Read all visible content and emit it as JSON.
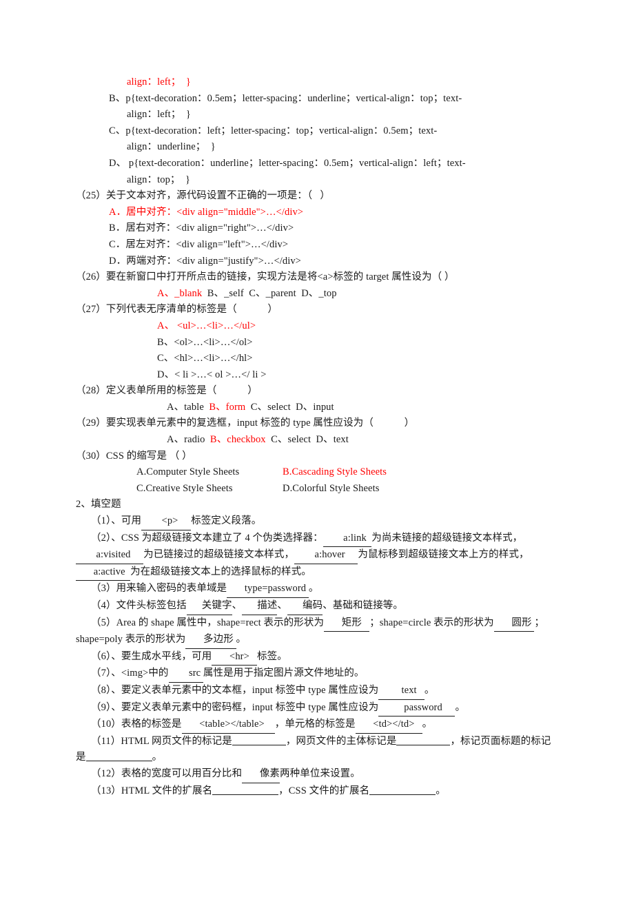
{
  "document": {
    "type": "exam-paper",
    "language": "zh-CN",
    "answer_color": "#ff0000",
    "text_color": "#1a1a1a",
    "background": "#ffffff"
  },
  "continued_question_24": {
    "note": "continuation of a previous multiple-choice question",
    "option_a_tail": "align：left；  }",
    "options": [
      {
        "label": "B、",
        "line1": "p{text-decoration：0.5em；letter-spacing：underline；vertical-align：top；text-",
        "line2": "align：left；  }",
        "is_answer": false
      },
      {
        "label": "C、",
        "line1": "p{text-decoration：left；letter-spacing：top；vertical-align：0.5em；text-",
        "line2": "align：underline；  }",
        "is_answer": false
      },
      {
        "label": "D、",
        "line1": " p{text-decoration：underline；letter-spacing：0.5em；vertical-align：left；text-",
        "line2": "align：top；  }",
        "is_answer": false
      }
    ]
  },
  "questions": [
    {
      "number": "（25）",
      "stem": "关于文本对齐，源代码设置不正确的一项是：（   ）",
      "layout": "stacked",
      "options": [
        {
          "text": "A．居中对齐：<div align=\"middle\">…</div>",
          "is_answer": true
        },
        {
          "text": "B．居右对齐：<div align=\"right\">…</div>",
          "is_answer": false
        },
        {
          "text": "C．居左对齐：<div align=\"left\">…</div>",
          "is_answer": false
        },
        {
          "text": "D．两端对齐：<div align=\"justify\">…</div>",
          "is_answer": false
        }
      ]
    },
    {
      "number": "（26）",
      "stem": "要在新窗口中打开所点击的链接，实现方法是将<a>标签的 target 属性设为（ ）",
      "layout": "inline",
      "options": [
        {
          "text": "A、_blank",
          "is_answer": true
        },
        {
          "text": "B、_self",
          "is_answer": false
        },
        {
          "text": "C、_parent",
          "is_answer": false
        },
        {
          "text": "D、_top",
          "is_answer": false
        }
      ]
    },
    {
      "number": "（27）",
      "stem": "下列代表无序清单的标签是（            ）",
      "layout": "stacked",
      "options": [
        {
          "text": "A、 <ul>…<li>…</ul>",
          "is_answer": true
        },
        {
          "text": "B、<ol>…<li>…</ol>",
          "is_answer": false
        },
        {
          "text": "C、<hl>…<li>…</hl>",
          "is_answer": false
        },
        {
          "text": "D、< li >…< ol >…</ li >",
          "is_answer": false
        }
      ]
    },
    {
      "number": "（28）",
      "stem": "定义表单所用的标签是（            ）",
      "layout": "inline",
      "options": [
        {
          "text": "A、table",
          "is_answer": false
        },
        {
          "text": "B、form",
          "is_answer": true
        },
        {
          "text": "C、select",
          "is_answer": false
        },
        {
          "text": "D、input",
          "is_answer": false
        }
      ]
    },
    {
      "number": "（29）",
      "stem": "要实现表单元素中的复选框，input 标签的 type 属性应设为（            ）",
      "layout": "inline",
      "options": [
        {
          "text": "A、radio",
          "is_answer": false
        },
        {
          "text": "B、checkbox",
          "is_answer": true
        },
        {
          "text": "C、select",
          "is_answer": false
        },
        {
          "text": "D、text",
          "is_answer": false
        }
      ]
    },
    {
      "number": "（30）",
      "stem": "CSS 的缩写是 （ ）",
      "layout": "two-column",
      "options": [
        {
          "text": "A.Computer Style Sheets",
          "is_answer": false
        },
        {
          "text": "B.Cascading Style Sheets",
          "is_answer": true
        },
        {
          "text": "C.Creative Style Sheets",
          "is_answer": false
        },
        {
          "text": "D.Colorful Style Sheets",
          "is_answer": false
        }
      ]
    }
  ],
  "fill_in_section": {
    "heading": "2、填空题",
    "items": [
      {
        "number": "（1）、",
        "parts": [
          {
            "t": "可用",
            "k": "text"
          },
          {
            "t": "  <p>     ",
            "k": "blank"
          },
          {
            "t": "标签定义段落。",
            "k": "text"
          }
        ]
      },
      {
        "number": "（2）、",
        "parts": [
          {
            "t": "CSS 为超级链接文本建立了 4 个伪类选择器：",
            "k": "text"
          },
          {
            "t": "  a:link  ",
            "k": "blank"
          },
          {
            "t": "为尚未链接的超级链接文本样式，",
            "k": "text"
          },
          {
            "t": "  a:visited     ",
            "k": "blank"
          },
          {
            "t": "为已链接过的超级链接文本样式，",
            "k": "text"
          },
          {
            "t": "  a:hover     ",
            "k": "blank"
          },
          {
            "t": "为鼠标移到超级链接文本上方的样式，",
            "k": "text"
          },
          {
            "t": " a:active  ",
            "k": "blank"
          },
          {
            "t": "为在超级链接文本上的选择鼠标的样式。",
            "k": "text"
          }
        ]
      },
      {
        "number": "（3）",
        "parts": [
          {
            "t": "用来输入密码的表单域是",
            "k": "text"
          },
          {
            "t": " type=password ",
            "k": "blank"
          },
          {
            "t": "。",
            "k": "text"
          }
        ]
      },
      {
        "number": "（4）",
        "parts": [
          {
            "t": "文件头标签包括",
            "k": "text"
          },
          {
            "t": "关键字",
            "k": "blank"
          },
          {
            "t": "、",
            "k": "text"
          },
          {
            "t": "描述",
            "k": "blank"
          },
          {
            "t": "、",
            "k": "text"
          },
          {
            "t": "编码",
            "k": "blank"
          },
          {
            "t": "、基础和链接等。",
            "k": "text"
          }
        ]
      },
      {
        "number": "（5）",
        "parts": [
          {
            "t": "Area 的 shape 属性中，shape=rect 表示的形状为",
            "k": "text"
          },
          {
            "t": " 矩形   ",
            "k": "blank"
          },
          {
            "t": "；shape=circle 表示的形状为",
            "k": "text"
          },
          {
            "t": " 圆形 ",
            "k": "blank"
          },
          {
            "t": "；shape=poly 表示的形状为",
            "k": "text"
          },
          {
            "t": " 多边形 ",
            "k": "blank"
          },
          {
            "t": "。",
            "k": "text"
          }
        ]
      },
      {
        "number": "（6）、",
        "parts": [
          {
            "t": "要生成水平线，可用",
            "k": "text"
          },
          {
            "t": " <hr>   ",
            "k": "blank"
          },
          {
            "t": "标签。",
            "k": "text"
          }
        ]
      },
      {
        "number": "（7）、",
        "parts": [
          {
            "t": "<img>中的",
            "k": "text"
          },
          {
            "t": "  src ",
            "k": "blank"
          },
          {
            "t": "属性是用于指定图片源文件地址的。",
            "k": "text"
          }
        ]
      },
      {
        "number": "（8）、",
        "parts": [
          {
            "t": "要定义表单元素中的文本框，input 标签中 type 属性应设为",
            "k": "text"
          },
          {
            "t": "   text   ",
            "k": "blank"
          },
          {
            "t": "。",
            "k": "text"
          }
        ]
      },
      {
        "number": "（9）、",
        "parts": [
          {
            "t": "要定义表单元素中的密码框，input 标签中 type 属性应设为",
            "k": "text"
          },
          {
            "t": "    password     ",
            "k": "blank"
          },
          {
            "t": "。",
            "k": "text"
          }
        ]
      },
      {
        "number": "（10）",
        "parts": [
          {
            "t": "表格的标签是",
            "k": "text"
          },
          {
            "t": " <table></table>    ",
            "k": "blank"
          },
          {
            "t": "，单元格的标签是",
            "k": "text"
          },
          {
            "t": " <td></td>   ",
            "k": "blank"
          },
          {
            "t": "。",
            "k": "text"
          }
        ]
      },
      {
        "number": "（11）",
        "parts": [
          {
            "t": "HTML 网页文件的标记是",
            "k": "text"
          },
          {
            "t": "",
            "k": "blank-empty-md"
          },
          {
            "t": "，网页文件的主体标记是",
            "k": "text"
          },
          {
            "t": "",
            "k": "blank-empty-md"
          },
          {
            "t": "，标记页面标题的标记是",
            "k": "text"
          },
          {
            "t": "",
            "k": "blank-empty-lg"
          },
          {
            "t": "。",
            "k": "text"
          }
        ]
      },
      {
        "number": "（12）",
        "parts": [
          {
            "t": "表格的宽度可以用百分比和",
            "k": "text"
          },
          {
            "t": " 像素",
            "k": "blank"
          },
          {
            "t": "两种单位来设置。",
            "k": "text"
          }
        ]
      },
      {
        "number": "（13）",
        "parts": [
          {
            "t": "HTML 文件的扩展名",
            "k": "text"
          },
          {
            "t": "",
            "k": "blank-empty-lg"
          },
          {
            "t": "，CSS 文件的扩展名",
            "k": "text"
          },
          {
            "t": "",
            "k": "blank-empty-lg"
          },
          {
            "t": "。",
            "k": "text"
          }
        ]
      }
    ]
  }
}
